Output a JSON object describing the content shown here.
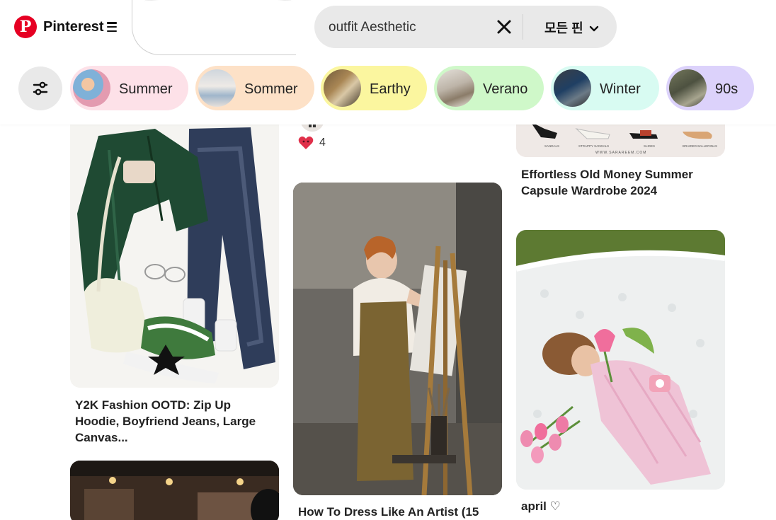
{
  "header": {
    "brand": "Pinterest",
    "search": {
      "value": "outfit Aesthetic",
      "placeholder": ""
    },
    "scope_label": "모든 핀"
  },
  "colors": {
    "brand": "#e60023",
    "search_bg": "#e9e9e9"
  },
  "chips": [
    {
      "label": "Summer",
      "bg": "#fde1e8"
    },
    {
      "label": "Sommer",
      "bg": "#fde1c7"
    },
    {
      "label": "Earthy",
      "bg": "#fbf69f"
    },
    {
      "label": "Verano",
      "bg": "#cff8c9"
    },
    {
      "label": "Winter",
      "bg": "#d8fbf2"
    },
    {
      "label": "90s",
      "bg": "#dcd2fb"
    }
  ],
  "pins": [
    {
      "title": "Y2K Fashion OOTD: Zip Up Hoodie, Boyfriend Jeans, Large Canvas..."
    },
    {
      "title": "How To Dress Like An Artist (15"
    },
    {
      "title": "Effortless Old Money Summer Capsule Wardrobe 2024"
    },
    {
      "title": "april ♡"
    }
  ],
  "reaction": {
    "count": "4"
  },
  "icons": {
    "logo": "pinterest-logo-icon",
    "menu": "hamburger-menu-icon",
    "clear": "close-icon",
    "scope": "chevron-down-icon",
    "filter": "filter-sliders-icon",
    "reaction": "heart-reaction-icon"
  },
  "partial_text": {
    "shoe_labels": [
      "SANDALS",
      "STRAPPY SANDALS",
      "SLIDES",
      "BRAIDED BALLERINAS"
    ],
    "site": "WWW.SARAREEM.COM"
  }
}
